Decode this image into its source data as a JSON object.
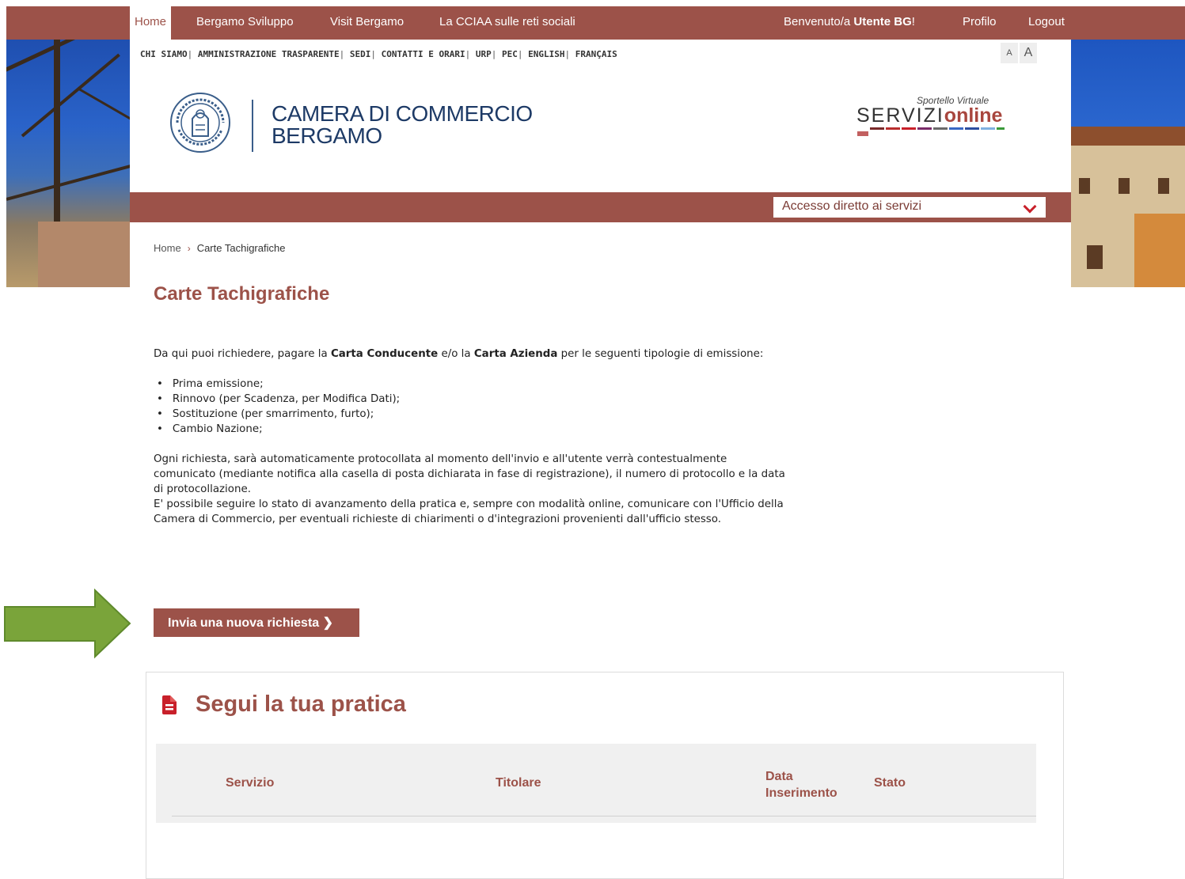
{
  "top_nav": {
    "items": [
      "Home",
      "Bergamo Sviluppo",
      "Visit Bergamo",
      "La CCIAA sulle reti sociali"
    ],
    "welcome_prefix": "Benvenuto/a ",
    "welcome_user": "Utente BG",
    "welcome_suffix": "!",
    "profile": "Profilo",
    "logout": "Logout"
  },
  "util_links": [
    "CHI SIAMO",
    "AMMINISTRAZIONE TRASPARENTE",
    "SEDI",
    "CONTATTI E ORARI",
    "URP",
    "PEC",
    "ENGLISH",
    "FRANÇAIS"
  ],
  "font_controls": {
    "small": "A",
    "large": "A"
  },
  "logo": {
    "seal_text": "BERGAMASCHI AL SERVIZIO DEI VALORI",
    "line1": "CAMERA DI COMMERCIO",
    "line2": "BERGAMO"
  },
  "servizi_online": {
    "caption": "Sportello Virtuale",
    "part1": "SERVIZI",
    "part2": "online"
  },
  "service_select": {
    "label": "Accesso diretto ai servizi"
  },
  "breadcrumb": {
    "home": "Home",
    "current": "Carte Tachigrafiche"
  },
  "page_title": "Carte Tachigrafiche",
  "intro": {
    "p1_a": "Da qui puoi richiedere, pagare la ",
    "p1_b": "Carta Conducente",
    "p1_c": " e/o la ",
    "p1_d": "Carta Azienda",
    "p1_e": " per le seguenti tipologie di emissione:",
    "list": [
      "Prima emissione;",
      "Rinnovo (per Scadenza, per Modifica Dati);",
      "Sostituzione (per smarrimento, furto);",
      "Cambio Nazione;"
    ],
    "p2": "Ogni richiesta, sarà automaticamente protocollata al momento dell'invio e all'utente verrà contestualmente comunicato (mediante notifica alla casella di posta dichiarata in fase di registrazione), il numero di protocollo e la data di protocollazione.",
    "p3": "E' possibile seguire lo stato di avanzamento della pratica e, sempre con modalità online, comunicare con l'Ufficio della Camera di Commercio, per eventuali richieste di chiarimenti o d'integrazioni provenienti dall'ufficio stesso."
  },
  "cta": {
    "label": "Invia una nuova richiesta  ❯"
  },
  "panel": {
    "title": "Segui la tua pratica",
    "columns": [
      "Servizio",
      "Titolare",
      "Data Inserimento",
      "Stato"
    ]
  },
  "colors": {
    "brand": "#9c5249",
    "accent_red": "#c8202a",
    "annotation_arrow": "#7aa43a"
  }
}
